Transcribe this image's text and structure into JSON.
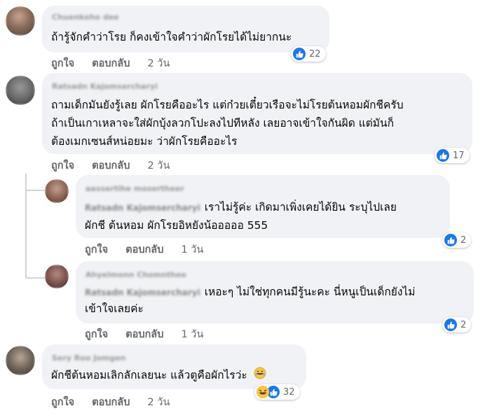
{
  "comments": [
    {
      "author": "Chuenkoho dee",
      "lines": [
        "ถ้ารู้จักคำว่าโรย ก็คงเข้าใจคำว่าผักโรยได้ไม่ยากนะ"
      ],
      "actions": {
        "like": "ถูกใจ",
        "reply": "ตอบกลับ",
        "time": "2 วัน"
      },
      "reaction_count": "22"
    },
    {
      "author": "Ratsadn Kajomsercharyi",
      "lines": [
        "ถามเด็กมันยังรู้เลย ผักโรยคืออะไร แต่ก๋วยเตี๋ยวเรือจะไม่โรยต้นหอมผักชีครับ",
        "ถ้าเป็นเกาเหลาจะใส่ผักบุ้งลวกโปะลงไปทีหลัง เลยอาจเข้าใจกันผิด แต่มันก็",
        "ต้องเมกเซนส์หน่อยมะ ว่าผักโรยคืออะไร"
      ],
      "actions": {
        "like": "ถูกใจ",
        "reply": "ตอบกลับ",
        "time": "2 วัน"
      },
      "reaction_count": "17"
    },
    {
      "author": "aassertihe mosertheer",
      "mention": "Ratsadn Kajomsercharyi",
      "lines": [
        "เราไม่รู้ค่ะ เกิดมาเพิ่งเคยได้ยิน ระบุไปเลย",
        "ผักชี ต้นหอม ผักโรยอิหยังน้อออออ 555"
      ],
      "actions": {
        "like": "ถูกใจ",
        "reply": "ตอบกลับ",
        "time": "1 วัน"
      },
      "reaction_count": "2"
    },
    {
      "author": "Ahyelmonn Chomnthee",
      "mention": "Ratsadn Kajomsercharyi",
      "lines": [
        "เหอะๆ ไม่ใช่ทุกคนมีรู้นะคะ นี่หนูเป็นเด็กยังไม่",
        "เข้าใจเลยค่ะ"
      ],
      "actions": {
        "like": "ถูกใจ",
        "reply": "ตอบกลับ",
        "time": "1 วัน"
      },
      "reaction_count": "2"
    },
    {
      "author": "Sery Roo Jomgen",
      "lines": [
        "ผักชีต้นหอมเลิกลักเลยนะ แล้วตูคือผักไรว่ะ"
      ],
      "actions": {
        "like": "ถูกใจ",
        "reply": "ตอบกลับ",
        "time": "2 วัน"
      },
      "reaction_count": "32"
    }
  ],
  "colors": {
    "like_blue": "#1877f2",
    "bubble": "#f0f2f5",
    "meta_gray": "#65676b"
  },
  "icons": {
    "like": "thumbs-up-icon",
    "haha": "laughing-emoji-icon",
    "rofl": "rofl-emoji-icon"
  }
}
